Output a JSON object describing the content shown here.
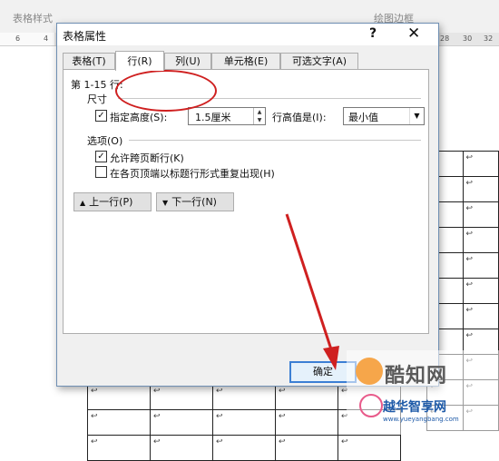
{
  "ribbon": {
    "group_table_style": "表格样式",
    "group_draw_borders": "绘图边框"
  },
  "ruler": {
    "ticks": [
      "6",
      "4",
      "28",
      "30",
      "32"
    ]
  },
  "doc": {
    "cell_mark": "↩"
  },
  "dialog": {
    "title": "表格属性",
    "help": "?",
    "close": "✕",
    "tabs": [
      "表格(T)",
      "行(R)",
      "列(U)",
      "单元格(E)",
      "可选文字(A)"
    ],
    "selected_tab": "行(R)",
    "rows_label": "第 1-15 行:",
    "size_section": "尺寸",
    "specify_height_label": "指定高度(S):",
    "specify_height_checked": true,
    "height_value": "1.5厘米",
    "row_height_is_label": "行高值是(I):",
    "row_height_mode": "最小值",
    "options_section": "选项(O)",
    "option_allow_break": "允许跨页断行(K)",
    "option_allow_break_checked": true,
    "option_repeat_header": "在各页顶端以标题行形式重复出现(H)",
    "option_repeat_header_checked": false,
    "prev_row_button": "上一行(P)",
    "next_row_button": "下一行(N)",
    "ok_button": "确定"
  },
  "watermark": {
    "brand": "酷知网",
    "site_name": "越华智享网",
    "url": "www.yueyangbang.com"
  },
  "colors": {
    "annotation_red": "#cf2020",
    "focus_blue": "#3c7fd4"
  }
}
